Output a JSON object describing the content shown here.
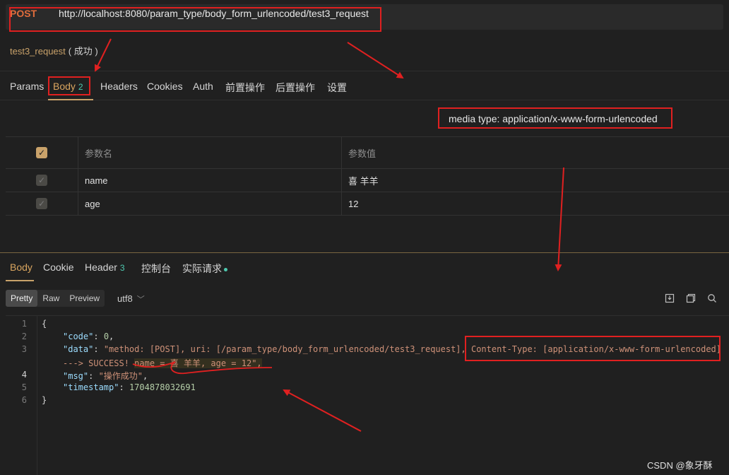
{
  "request": {
    "method": "POST",
    "url": "http://localhost:8080/param_type/body_form_urlencoded/test3_request",
    "name": "test3_request",
    "status": "( 成功 )"
  },
  "tabs": [
    {
      "label": "Params"
    },
    {
      "label": "Body",
      "badge": "2"
    },
    {
      "label": "Headers"
    },
    {
      "label": "Cookies"
    },
    {
      "label": "Auth"
    },
    {
      "label": "前置操作"
    },
    {
      "label": "后置操作"
    },
    {
      "label": "设置"
    }
  ],
  "media_type": "media type: application/x-www-form-urlencoded",
  "params_table": {
    "headers": [
      "参数名",
      "参数值"
    ],
    "rows": [
      {
        "name": "name",
        "value": "喜 羊羊"
      },
      {
        "name": "age",
        "value": "12"
      }
    ]
  },
  "response_tabs": [
    {
      "label": "Body"
    },
    {
      "label": "Cookie"
    },
    {
      "label": "Header",
      "badge": "3"
    },
    {
      "label": "控制台"
    },
    {
      "label": "实际请求"
    }
  ],
  "format_buttons": [
    "Pretty",
    "Raw",
    "Preview"
  ],
  "encoding": "utf8",
  "code": {
    "line_numbers": [
      "1",
      "2",
      "3",
      "4",
      "5",
      "6"
    ],
    "open_brace": "{",
    "code_key": "\"code\"",
    "code_val": "0",
    "data_key": "\"data\"",
    "data_val_1": "\"method: [POST], uri: [/param_type/body_form_urlencoded/test3_request], ",
    "data_val_ct": "Content-Type: [application/x-www-form-urlencoded]",
    "data_val_2a": "---> SUCCESS! ",
    "data_val_2b": "name = 喜 羊羊, age = 12\",",
    "msg_key": "\"msg\"",
    "msg_val": "\"操作成功\"",
    "ts_key": "\"timestamp\"",
    "ts_val": "1704878032691",
    "close_brace": "}"
  },
  "watermark": "CSDN @象牙酥",
  "colors": {
    "accent": "#c9a26a",
    "annotation": "#e02020",
    "method": "#e06c3c"
  }
}
